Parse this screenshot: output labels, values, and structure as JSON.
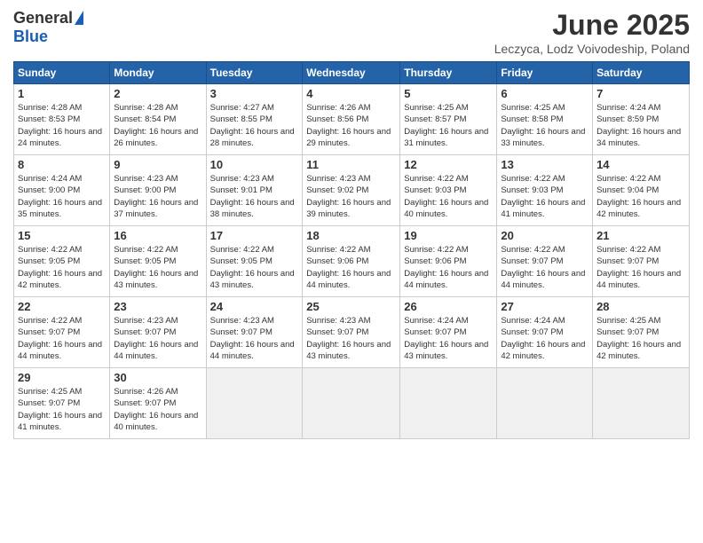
{
  "logo": {
    "general": "General",
    "blue": "Blue"
  },
  "title": "June 2025",
  "location": "Leczyca, Lodz Voivodeship, Poland",
  "weekdays": [
    "Sunday",
    "Monday",
    "Tuesday",
    "Wednesday",
    "Thursday",
    "Friday",
    "Saturday"
  ],
  "weeks": [
    [
      {
        "day": 1,
        "sunrise": "4:28 AM",
        "sunset": "8:53 PM",
        "daylight": "16 hours and 24 minutes."
      },
      {
        "day": 2,
        "sunrise": "4:28 AM",
        "sunset": "8:54 PM",
        "daylight": "16 hours and 26 minutes."
      },
      {
        "day": 3,
        "sunrise": "4:27 AM",
        "sunset": "8:55 PM",
        "daylight": "16 hours and 28 minutes."
      },
      {
        "day": 4,
        "sunrise": "4:26 AM",
        "sunset": "8:56 PM",
        "daylight": "16 hours and 29 minutes."
      },
      {
        "day": 5,
        "sunrise": "4:25 AM",
        "sunset": "8:57 PM",
        "daylight": "16 hours and 31 minutes."
      },
      {
        "day": 6,
        "sunrise": "4:25 AM",
        "sunset": "8:58 PM",
        "daylight": "16 hours and 33 minutes."
      },
      {
        "day": 7,
        "sunrise": "4:24 AM",
        "sunset": "8:59 PM",
        "daylight": "16 hours and 34 minutes."
      }
    ],
    [
      {
        "day": 8,
        "sunrise": "4:24 AM",
        "sunset": "9:00 PM",
        "daylight": "16 hours and 35 minutes."
      },
      {
        "day": 9,
        "sunrise": "4:23 AM",
        "sunset": "9:00 PM",
        "daylight": "16 hours and 37 minutes."
      },
      {
        "day": 10,
        "sunrise": "4:23 AM",
        "sunset": "9:01 PM",
        "daylight": "16 hours and 38 minutes."
      },
      {
        "day": 11,
        "sunrise": "4:23 AM",
        "sunset": "9:02 PM",
        "daylight": "16 hours and 39 minutes."
      },
      {
        "day": 12,
        "sunrise": "4:22 AM",
        "sunset": "9:03 PM",
        "daylight": "16 hours and 40 minutes."
      },
      {
        "day": 13,
        "sunrise": "4:22 AM",
        "sunset": "9:03 PM",
        "daylight": "16 hours and 41 minutes."
      },
      {
        "day": 14,
        "sunrise": "4:22 AM",
        "sunset": "9:04 PM",
        "daylight": "16 hours and 42 minutes."
      }
    ],
    [
      {
        "day": 15,
        "sunrise": "4:22 AM",
        "sunset": "9:05 PM",
        "daylight": "16 hours and 42 minutes."
      },
      {
        "day": 16,
        "sunrise": "4:22 AM",
        "sunset": "9:05 PM",
        "daylight": "16 hours and 43 minutes."
      },
      {
        "day": 17,
        "sunrise": "4:22 AM",
        "sunset": "9:05 PM",
        "daylight": "16 hours and 43 minutes."
      },
      {
        "day": 18,
        "sunrise": "4:22 AM",
        "sunset": "9:06 PM",
        "daylight": "16 hours and 44 minutes."
      },
      {
        "day": 19,
        "sunrise": "4:22 AM",
        "sunset": "9:06 PM",
        "daylight": "16 hours and 44 minutes."
      },
      {
        "day": 20,
        "sunrise": "4:22 AM",
        "sunset": "9:07 PM",
        "daylight": "16 hours and 44 minutes."
      },
      {
        "day": 21,
        "sunrise": "4:22 AM",
        "sunset": "9:07 PM",
        "daylight": "16 hours and 44 minutes."
      }
    ],
    [
      {
        "day": 22,
        "sunrise": "4:22 AM",
        "sunset": "9:07 PM",
        "daylight": "16 hours and 44 minutes."
      },
      {
        "day": 23,
        "sunrise": "4:23 AM",
        "sunset": "9:07 PM",
        "daylight": "16 hours and 44 minutes."
      },
      {
        "day": 24,
        "sunrise": "4:23 AM",
        "sunset": "9:07 PM",
        "daylight": "16 hours and 44 minutes."
      },
      {
        "day": 25,
        "sunrise": "4:23 AM",
        "sunset": "9:07 PM",
        "daylight": "16 hours and 43 minutes."
      },
      {
        "day": 26,
        "sunrise": "4:24 AM",
        "sunset": "9:07 PM",
        "daylight": "16 hours and 43 minutes."
      },
      {
        "day": 27,
        "sunrise": "4:24 AM",
        "sunset": "9:07 PM",
        "daylight": "16 hours and 42 minutes."
      },
      {
        "day": 28,
        "sunrise": "4:25 AM",
        "sunset": "9:07 PM",
        "daylight": "16 hours and 42 minutes."
      }
    ],
    [
      {
        "day": 29,
        "sunrise": "4:25 AM",
        "sunset": "9:07 PM",
        "daylight": "16 hours and 41 minutes."
      },
      {
        "day": 30,
        "sunrise": "4:26 AM",
        "sunset": "9:07 PM",
        "daylight": "16 hours and 40 minutes."
      },
      null,
      null,
      null,
      null,
      null
    ]
  ]
}
